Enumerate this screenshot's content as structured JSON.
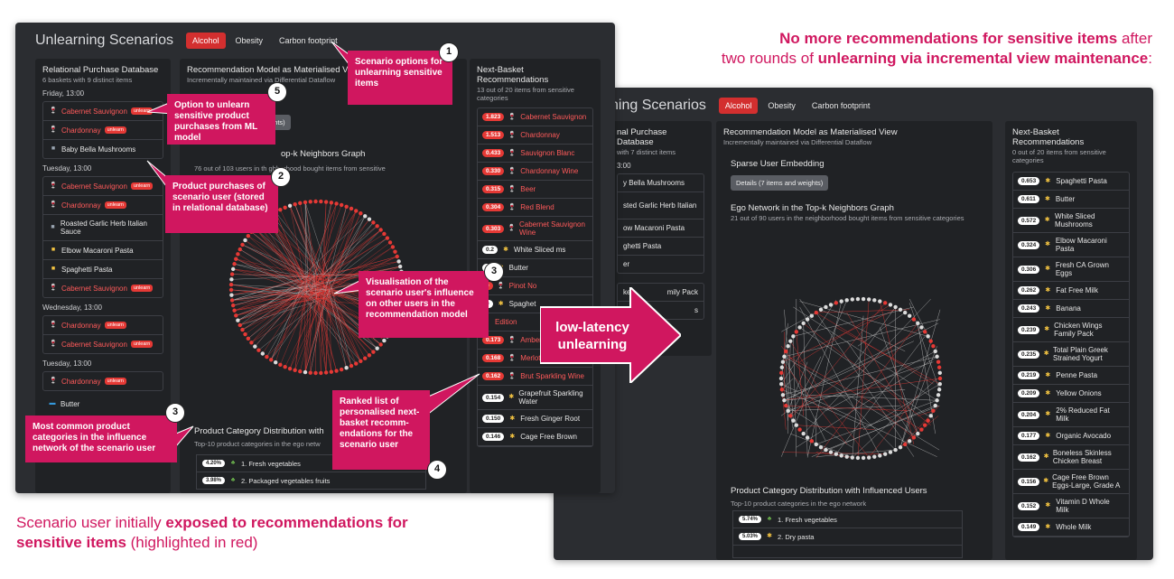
{
  "caption_top": {
    "part1": "No more recommendations for sensitive items",
    "part2": " after",
    "part3": "two rounds of ",
    "part4": "unlearning via incremental view maintenance",
    "part5": ":"
  },
  "caption_bottom": {
    "part1": "Scenario user initially ",
    "part2": "exposed to recommendations for",
    "part3": "sensitive items",
    "part4": " (highlighted in red)"
  },
  "arrow_label": [
    "low-latency",
    "unlearning"
  ],
  "callouts": {
    "c1": {
      "num": "1",
      "text": "Scenario options for unlearning sensitive items"
    },
    "c5": {
      "num": "5",
      "text": "Option to unlearn sensitive product purchases from ML model"
    },
    "c2": {
      "num": "2",
      "text": "Product purchases of scenario user (stored in relational database)"
    },
    "c3a": {
      "num": "3",
      "text": "Visualisation of the scenario user's influence on other users in the recommendation model"
    },
    "c3b": {
      "num": "3",
      "text": "Most common product categories in the influence network of the scenario user"
    },
    "c4": {
      "num": "4",
      "text": "Ranked list of personalised next-basket recomm-endations for the scenario user"
    }
  },
  "left": {
    "app_title": "Unlearning Scenarios",
    "tabs": [
      "Alcohol",
      "Obesity",
      "Carbon footprint"
    ],
    "db": {
      "title": "Relational Purchase Database",
      "sub": "6 baskets with 9 distinct items",
      "days": [
        {
          "label": "Friday, 13:00",
          "items": [
            {
              "name": "Cabernet Sauvignon",
              "red": true,
              "icon": "wine-icon"
            },
            {
              "name": "Chardonnay",
              "red": true,
              "icon": "wine-icon"
            },
            {
              "name": "Baby Bella Mushrooms",
              "red": false,
              "icon": "mushroom-icon"
            }
          ]
        },
        {
          "label": "Tuesday, 13:00",
          "items": [
            {
              "name": "Cabernet Sauvignon",
              "red": true,
              "icon": "wine-icon"
            },
            {
              "name": "Chardonnay",
              "red": true,
              "icon": "wine-icon"
            },
            {
              "name": "Roasted Garlic Herb Italian Sauce",
              "red": false,
              "icon": "sauce-icon"
            },
            {
              "name": "Elbow Macaroni Pasta",
              "red": false,
              "icon": "pasta-icon"
            },
            {
              "name": "Spaghetti Pasta",
              "red": false,
              "icon": "pasta-icon"
            },
            {
              "name": "Cabernet Sauvignon",
              "red": true,
              "icon": "wine-icon"
            }
          ]
        },
        {
          "label": "Wednesday, 13:00",
          "items": [
            {
              "name": "Chardonnay",
              "red": true,
              "icon": "wine-icon"
            },
            {
              "name": "Cabernet Sauvignon",
              "red": true,
              "icon": "wine-icon"
            }
          ]
        },
        {
          "label": "Tuesday, 13:00",
          "items": [
            {
              "name": "Chardonnay",
              "red": true,
              "icon": "wine-icon"
            }
          ]
        }
      ],
      "tail_item": "Butter",
      "unlearn_label": "unlearn"
    },
    "model": {
      "title": "Recommendation Model as Materialised V",
      "sub": "Incrementally maintained via Differential Dataflow",
      "embedding_heading": "ng",
      "details_btn": "ghts)",
      "ego_heading": "op-k Neighbors Graph",
      "ego_sub": "76 out of 103 users in th  ghborhood bought items from sensitive",
      "dist_heading": "Product Category Distribution with",
      "dist_sub": "Top-10 product categories in the ego netw",
      "dist": [
        {
          "pct": "4.20%",
          "label": "1. Fresh vegetables"
        },
        {
          "pct": "3.98%",
          "label": "2. Packaged vegetables fruits"
        }
      ]
    },
    "recs": {
      "title": "Next-Basket Recommendations",
      "sub": "13 out of 20 items from sensitive categories",
      "items": [
        {
          "score": "1.823",
          "name": "Cabernet Sauvignon",
          "red": true
        },
        {
          "score": "1.513",
          "name": "Chardonnay",
          "red": true
        },
        {
          "score": "0.433",
          "name": "Sauvignon Blanc",
          "red": true
        },
        {
          "score": "0.330",
          "name": "Chardonnay Wine",
          "red": true
        },
        {
          "score": "0.315",
          "name": "Beer",
          "red": true
        },
        {
          "score": "0.304",
          "name": "Red Blend",
          "red": true
        },
        {
          "score": "0.303",
          "name": "Cabernet Sauvignon Wine",
          "red": true
        },
        {
          "score": "0.2",
          "name": "White Sliced ms",
          "red": false
        },
        {
          "score": "0",
          "name": "Butter",
          "red": false
        },
        {
          "score": "0",
          "name": "Pinot No",
          "red": true
        },
        {
          "score": "0",
          "name": "Spaghet",
          "red": false
        },
        {
          "score": "",
          "name": "Edition",
          "red": true
        },
        {
          "score": "0.173",
          "name": "Amber Ale",
          "red": true
        },
        {
          "score": "0.168",
          "name": "Merlot",
          "red": true
        },
        {
          "score": "0.162",
          "name": "Brut Sparkling Wine",
          "red": true
        },
        {
          "score": "0.154",
          "name": "Grapefruit Sparkling Water",
          "red": false
        },
        {
          "score": "0.150",
          "name": "Fresh Ginger Root",
          "red": false
        },
        {
          "score": "0.146",
          "name": "Cage Free Brown",
          "red": false
        }
      ]
    }
  },
  "right": {
    "app_title": "ning Scenarios",
    "tabs": [
      "Alcohol",
      "Obesity",
      "Carbon footprint"
    ],
    "db": {
      "title": "nal Purchase Database",
      "sub": "with 7 distinct items",
      "day": "3:00",
      "items": [
        "y Bella Mushrooms",
        "sted Garlic Herb Italian",
        "",
        "ow Macaroni Pasta",
        "ghetti Pasta",
        "er",
        "ken",
        "",
        "mily Pack",
        "s"
      ]
    },
    "model": {
      "title": "Recommendation Model as Materialised View",
      "sub": "Incrementally maintained via Differential Dataflow",
      "embedding_heading": "Sparse User Embedding",
      "details_btn": "Details (7 items and weights)",
      "ego_heading": "Ego Network in the Top-k Neighbors Graph",
      "ego_sub": "21 out of 90 users in the neighborhood bought items from sensitive categories",
      "dist_heading": "Product Category Distribution with Influenced Users",
      "dist_sub": "Top-10 product categories in the ego network",
      "dist": [
        {
          "pct": "5.74%",
          "label": "1. Fresh vegetables"
        },
        {
          "pct": "5.03%",
          "label": "2. Dry pasta"
        }
      ]
    },
    "recs": {
      "title": "Next-Basket Recommendations",
      "sub": "0 out of 20 items from sensitive categories",
      "items": [
        {
          "score": "0.653",
          "name": "Spaghetti Pasta"
        },
        {
          "score": "0.611",
          "name": "Butter"
        },
        {
          "score": "0.572",
          "name": "White Sliced Mushrooms"
        },
        {
          "score": "0.324",
          "name": "Elbow Macaroni Pasta"
        },
        {
          "score": "0.306",
          "name": "Fresh CA Grown Eggs"
        },
        {
          "score": "0.262",
          "name": "Fat Free Milk"
        },
        {
          "score": "0.243",
          "name": "Banana"
        },
        {
          "score": "0.239",
          "name": "Chicken Wings Family Pack"
        },
        {
          "score": "0.235",
          "name": "Total Plain Greek Strained Yogurt"
        },
        {
          "score": "0.219",
          "name": "Penne Pasta"
        },
        {
          "score": "0.209",
          "name": "Yellow Onions"
        },
        {
          "score": "0.204",
          "name": "2% Reduced Fat Milk"
        },
        {
          "score": "0.177",
          "name": "Organic Avocado"
        },
        {
          "score": "0.162",
          "name": "Boneless Skinless Chicken Breast"
        },
        {
          "score": "0.156",
          "name": "Cage Free Brown Eggs-Large, Grade A"
        },
        {
          "score": "0.152",
          "name": "Vitamin D Whole Milk"
        },
        {
          "score": "0.149",
          "name": "Whole Milk"
        }
      ]
    }
  },
  "colors": {
    "accent": "#d0175f",
    "sensitive": "#e53935",
    "panel": "#202225",
    "bg": "#2b2d31"
  }
}
